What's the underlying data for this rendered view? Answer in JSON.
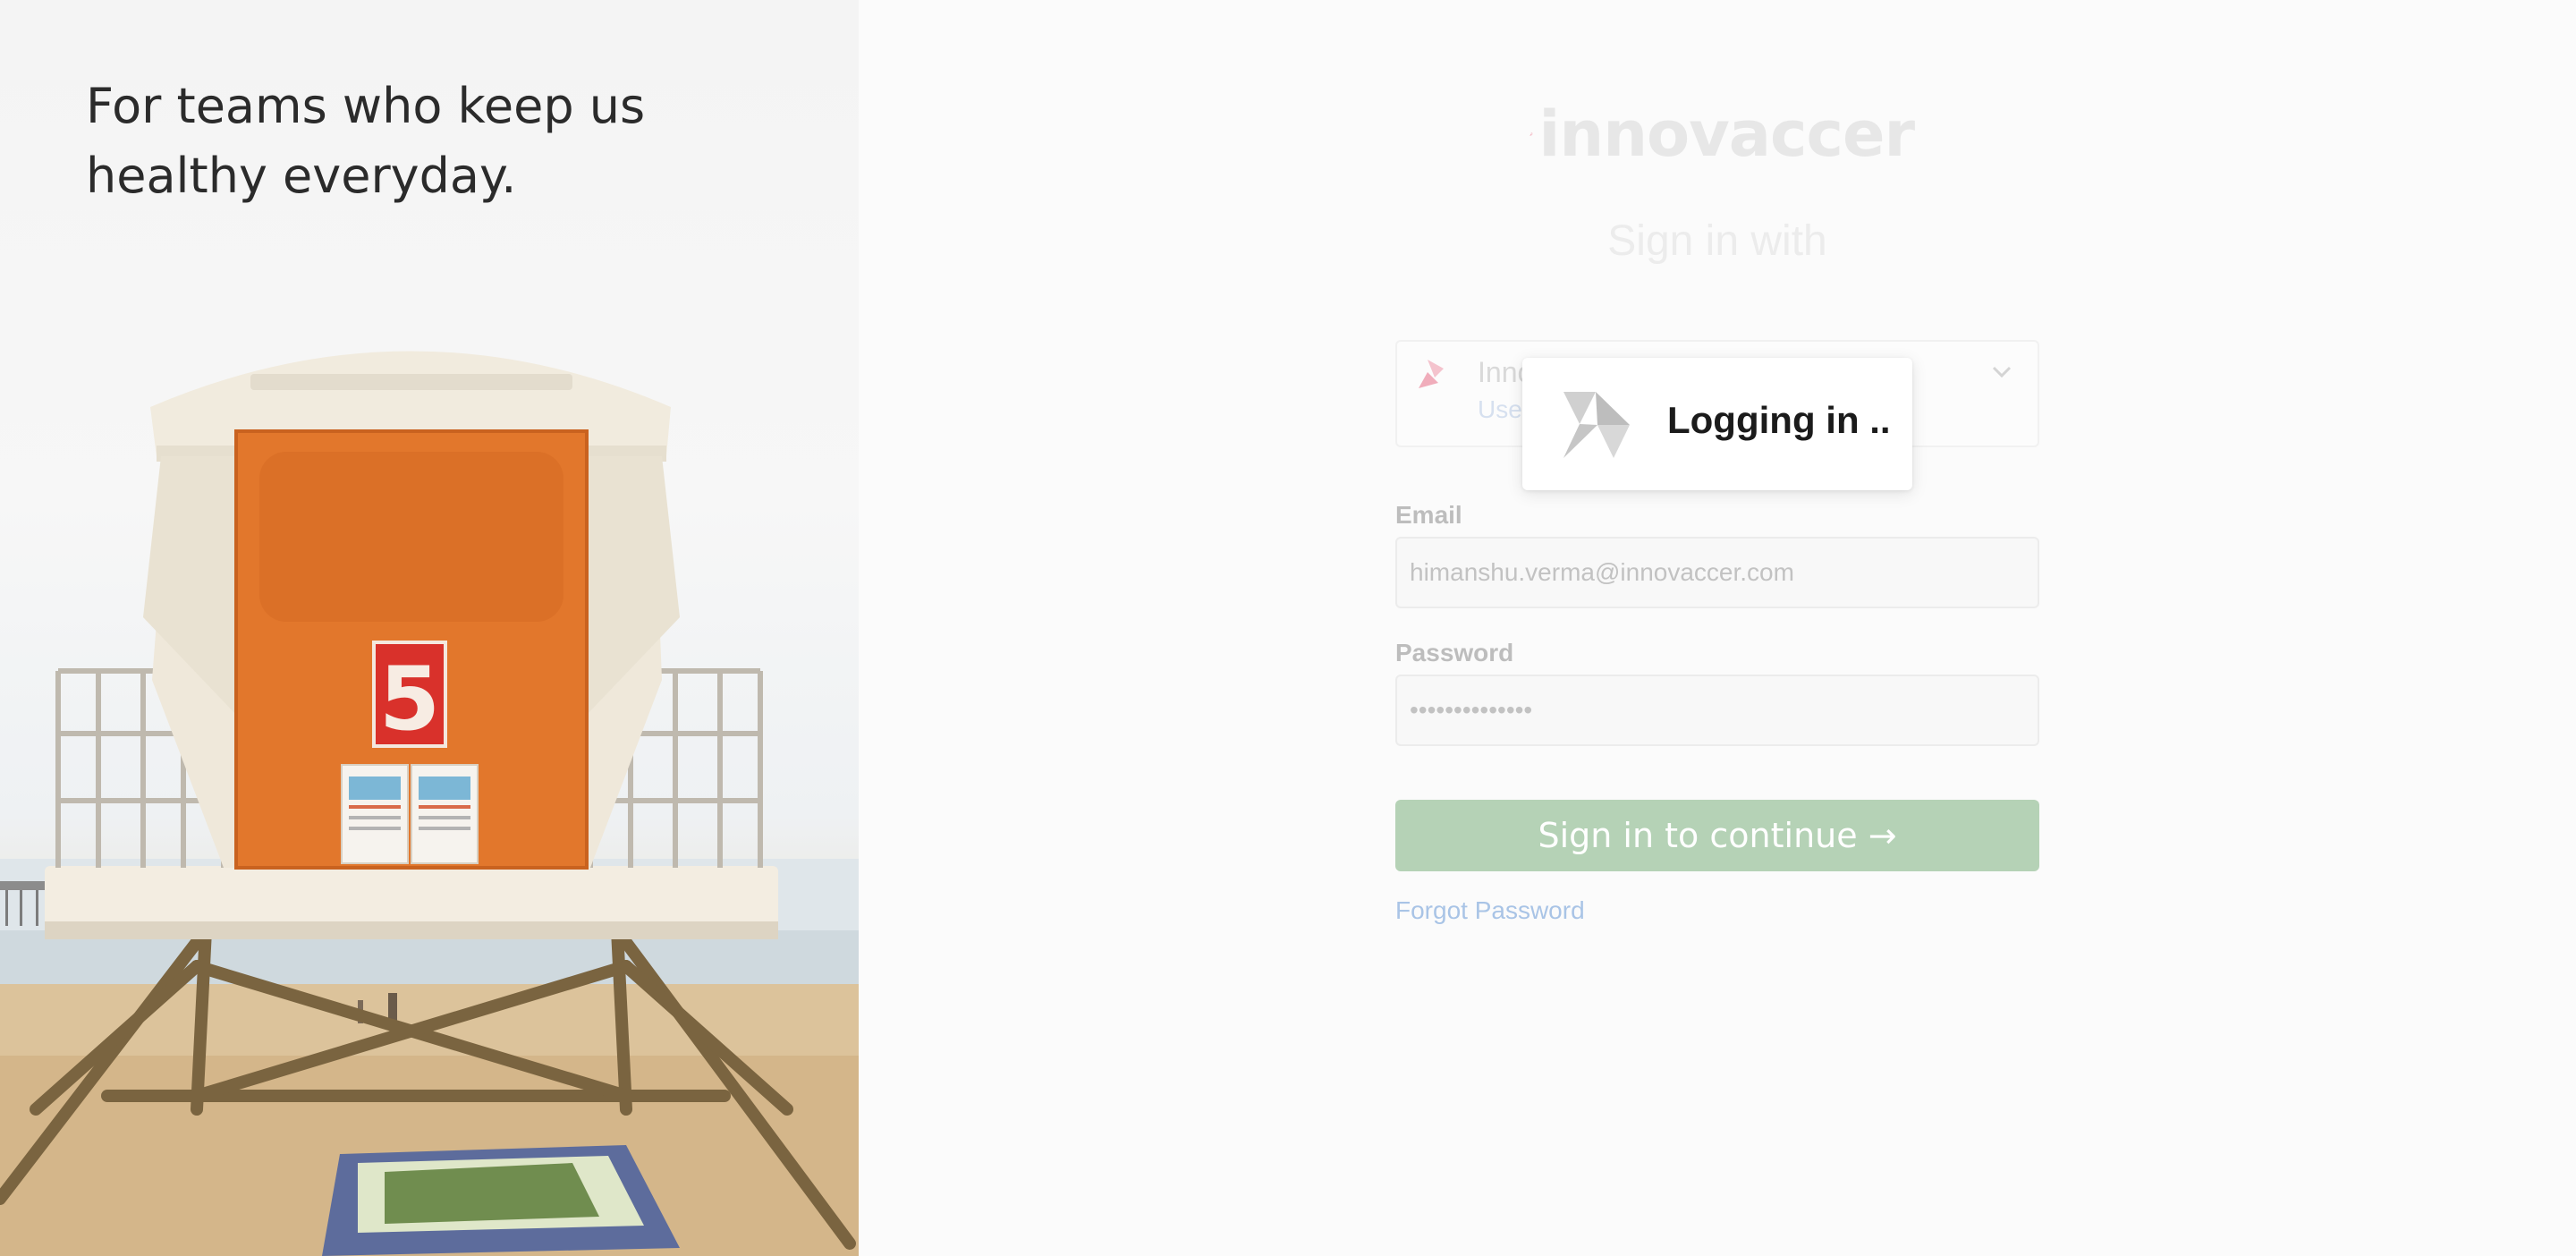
{
  "hero": {
    "title_line1": "For teams who keep us",
    "title_line2": "healthy everyday.",
    "tower_number": "5"
  },
  "brand": {
    "name": "innovaccer",
    "logo_icon": "innovaccer-logo-icon"
  },
  "login": {
    "heading": "Sign in with",
    "sso": {
      "name_visible": "Inno",
      "subtitle_visible": "Use",
      "chevron_icon": "chevron-down-icon"
    },
    "email": {
      "label": "Email",
      "value": "himanshu.verma@innovaccer.com"
    },
    "password": {
      "label": "Password",
      "value": "••••••••••••••"
    },
    "submit_label": "Sign in to continue →",
    "forgot_label": "Forgot Password"
  },
  "toast": {
    "message": "Logging in ..",
    "icon": "loading-spinner-icon"
  },
  "colors": {
    "brand_pink": "#f2b7c3",
    "button_green": "#b5d2b6",
    "link_blue": "#a9c4e6",
    "tower_orange": "#e2772c",
    "tower_red": "#d9312b"
  }
}
